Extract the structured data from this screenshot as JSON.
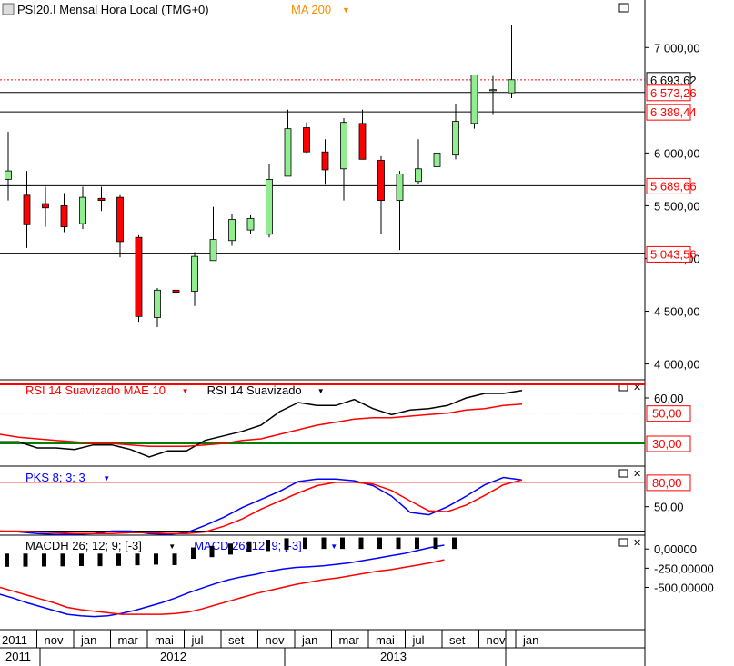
{
  "header": {
    "icon": "chart-window-icon",
    "title": "PSI20.I Mensal Hora Local (TMG+0)",
    "indicator": "MA 200",
    "indicator_color": "#ff8c00",
    "dropdown_icon": "chevron-down-icon"
  },
  "colors": {
    "up": "#90ee90",
    "down": "#ff0000",
    "red_line": "#ff0000",
    "black_line": "#000000",
    "blue_line": "#0000ff",
    "green_line": "#008000",
    "label_border": "#ff0000"
  },
  "chart_data": [
    {
      "type": "candlestick",
      "title": "PSI20.I Mensal Hora Local (TMG+0)",
      "ylim": [
        3850,
        7450
      ],
      "y_ticks": [
        {
          "v": 4000,
          "label": "4 000,00"
        },
        {
          "v": 4500,
          "label": "4 500,00"
        },
        {
          "v": 5000,
          "label": "5 000,00"
        },
        {
          "v": 5500,
          "label": "5 500,00"
        },
        {
          "v": 6000,
          "label": "6 000,00"
        },
        {
          "v": 7000,
          "label": "7 000,00"
        }
      ],
      "candles": [
        {
          "o": 5750,
          "h": 6200,
          "l": 5550,
          "c": 5830
        },
        {
          "o": 5600,
          "h": 5830,
          "l": 5100,
          "c": 5320
        },
        {
          "o": 5520,
          "h": 5680,
          "l": 5300,
          "c": 5480
        },
        {
          "o": 5500,
          "h": 5620,
          "l": 5250,
          "c": 5300
        },
        {
          "o": 5330,
          "h": 5680,
          "l": 5280,
          "c": 5580
        },
        {
          "o": 5570,
          "h": 5680,
          "l": 5450,
          "c": 5550
        },
        {
          "o": 5580,
          "h": 5600,
          "l": 5010,
          "c": 5160
        },
        {
          "o": 5200,
          "h": 5220,
          "l": 4400,
          "c": 4450
        },
        {
          "o": 4440,
          "h": 4720,
          "l": 4350,
          "c": 4700
        },
        {
          "o": 4700,
          "h": 4980,
          "l": 4400,
          "c": 4680
        },
        {
          "o": 4690,
          "h": 5060,
          "l": 4550,
          "c": 5020
        },
        {
          "o": 4980,
          "h": 5490,
          "l": 4980,
          "c": 5180
        },
        {
          "o": 5170,
          "h": 5420,
          "l": 5120,
          "c": 5370
        },
        {
          "o": 5270,
          "h": 5410,
          "l": 5230,
          "c": 5380
        },
        {
          "o": 5230,
          "h": 5900,
          "l": 5200,
          "c": 5750
        },
        {
          "o": 5780,
          "h": 6410,
          "l": 5780,
          "c": 6230
        },
        {
          "o": 6240,
          "h": 6290,
          "l": 6000,
          "c": 6010
        },
        {
          "o": 6010,
          "h": 6130,
          "l": 5700,
          "c": 5840
        },
        {
          "o": 5850,
          "h": 6330,
          "l": 5550,
          "c": 6290
        },
        {
          "o": 6280,
          "h": 6410,
          "l": 5950,
          "c": 5940
        },
        {
          "o": 5930,
          "h": 5970,
          "l": 5230,
          "c": 5550
        },
        {
          "o": 5550,
          "h": 5830,
          "l": 5080,
          "c": 5800
        },
        {
          "o": 5730,
          "h": 6130,
          "l": 5710,
          "c": 5850
        },
        {
          "o": 5870,
          "h": 6110,
          "l": 5870,
          "c": 6000
        },
        {
          "o": 5980,
          "h": 6460,
          "l": 5940,
          "c": 6300
        },
        {
          "o": 6280,
          "h": 6730,
          "l": 6230,
          "c": 6740
        },
        {
          "o": 6590,
          "h": 6730,
          "l": 6360,
          "c": 6600
        },
        {
          "o": 6570,
          "h": 7210,
          "l": 6520,
          "c": 6694
        }
      ],
      "levels": [
        {
          "v": 6693.62,
          "label": "6 693,62",
          "style": "dotted",
          "color": "#ff0000",
          "label_border": "#000000"
        },
        {
          "v": 6573.26,
          "label": "6 573,26",
          "style": "solid",
          "color": "#000000",
          "label_border": "#ff0000"
        },
        {
          "v": 6389.44,
          "label": "6 389,44",
          "style": "solid",
          "color": "#000000",
          "label_border": "#ff0000"
        },
        {
          "v": 5689.66,
          "label": "5 689,66",
          "style": "solid",
          "color": "#000000",
          "label_border": "#ff0000"
        },
        {
          "v": 5043.56,
          "label": "5 043,56",
          "style": "solid",
          "color": "#000000",
          "label_border": "#ff0000"
        }
      ]
    },
    {
      "type": "line",
      "series_labels": [
        {
          "text": "RSI 14 Suavizado MAE 10",
          "color": "#ff0000"
        },
        {
          "text": "RSI 14 Suavizado",
          "color": "#000000"
        }
      ],
      "ylim": [
        15,
        72
      ],
      "y_ticks": [
        {
          "v": 60,
          "label": "60,00"
        }
      ],
      "levels": [
        {
          "v": 50,
          "label": "50,00",
          "color": "#aaaaaa",
          "style": "dotted",
          "label_border": "#ff0000"
        },
        {
          "v": 30,
          "label": "30,00",
          "color": "#008000",
          "style": "solid",
          "label_border": "#ff0000"
        }
      ],
      "top_line_color": "#ff0000",
      "series": [
        {
          "name": "RSI 14 Suavizado",
          "color": "#000000",
          "values": [
            31,
            31,
            27,
            27,
            26,
            29,
            29,
            26,
            21,
            25,
            25,
            32,
            35,
            38,
            42,
            51,
            57,
            55,
            55,
            59,
            53,
            49,
            52,
            53,
            55,
            60,
            63,
            63,
            65
          ]
        },
        {
          "name": "RSI 14 Suavizado MAE 10",
          "color": "#ff0000",
          "values": [
            36,
            34,
            33,
            32,
            31,
            30,
            30,
            29,
            28,
            28,
            28,
            29,
            30,
            32,
            33,
            36,
            39,
            42,
            44,
            46,
            47,
            47,
            48,
            49,
            50,
            52,
            53,
            55,
            56
          ]
        }
      ]
    },
    {
      "type": "line",
      "series_labels": [
        {
          "text": "PKS 8; 3; 3",
          "color": "#0000ff"
        }
      ],
      "ylim": [
        15,
        100
      ],
      "y_ticks": [
        {
          "v": 50,
          "label": "50,00"
        }
      ],
      "levels": [
        {
          "v": 80,
          "label": "80,00",
          "color": "#ff0000",
          "style": "solid",
          "label_border": "#ff0000"
        },
        {
          "v": 20,
          "label": "",
          "color": "#000000",
          "style": "solid",
          "label_border": ""
        }
      ],
      "series": [
        {
          "name": "PKS 8; 3; 3",
          "color": "#0000ff",
          "values": [
            20,
            19,
            17,
            16,
            16,
            17,
            20,
            20,
            17,
            16,
            18,
            27,
            37,
            49,
            59,
            69,
            81,
            84,
            84,
            82,
            76,
            63,
            43,
            40,
            50,
            63,
            77,
            86,
            83
          ]
        },
        {
          "name": "",
          "color": "#ff0000",
          "values": [
            20,
            20,
            19,
            18,
            17,
            17,
            17,
            18,
            18,
            17,
            17,
            19,
            26,
            35,
            47,
            57,
            67,
            76,
            80,
            80,
            78,
            70,
            57,
            45,
            44,
            52,
            64,
            77,
            83
          ]
        }
      ]
    },
    {
      "type": "bar_line",
      "series_labels": [
        {
          "text": "MACDH 26; 12; 9; [-3]",
          "color": "#000000"
        },
        {
          "text": "MACD 26; 12; 9; [-3]",
          "color": "#0000ff"
        }
      ],
      "ylim": [
        -1050,
        180
      ],
      "y_ticks": [
        {
          "v": 0,
          "label": "0,00000"
        },
        {
          "v": -250,
          "label": "-250,00000"
        },
        {
          "v": -500,
          "label": "-500,00000"
        }
      ],
      "histogram": {
        "label": "MACDH 26; 12; 9; [-3]",
        "color": "#000000",
        "values": [
          -210,
          -200,
          -190,
          -180,
          -160,
          -170,
          -150,
          -110,
          -70,
          -20,
          20,
          40,
          70,
          100,
          120,
          140,
          150,
          150,
          150,
          150,
          150,
          150,
          150,
          150,
          150,
          150,
          150,
          150,
          150,
          150,
          150,
          150,
          150,
          150
        ]
      },
      "series": [
        {
          "name": "MACD 26; 12; 9; [-3]",
          "color": "#0000ff",
          "values": [
            -590,
            -640,
            -700,
            -750,
            -800,
            -850,
            -870,
            -880,
            -870,
            -840,
            -800,
            -750,
            -700,
            -640,
            -570,
            -510,
            -450,
            -400,
            -360,
            -330,
            -290,
            -260,
            -240,
            -230,
            -220,
            -200,
            -180,
            -150,
            -120,
            -90,
            -60,
            -20,
            20,
            50
          ]
        },
        {
          "name": "",
          "color": "#ff0000",
          "values": [
            -500,
            -550,
            -600,
            -650,
            -700,
            -760,
            -790,
            -810,
            -830,
            -850,
            -850,
            -850,
            -850,
            -840,
            -820,
            -780,
            -730,
            -680,
            -630,
            -580,
            -540,
            -500,
            -460,
            -430,
            -400,
            -380,
            -350,
            -320,
            -290,
            -270,
            -240,
            -210,
            -180,
            -140
          ]
        }
      ]
    }
  ],
  "time_axis": {
    "months": [
      "2011",
      "nov",
      "jan",
      "mar",
      "mai",
      "jul",
      "set",
      "nov",
      "jan",
      "mar",
      "mai",
      "jul",
      "set",
      "nov",
      "jan"
    ],
    "years": [
      "2011",
      "2012",
      "2013"
    ]
  }
}
